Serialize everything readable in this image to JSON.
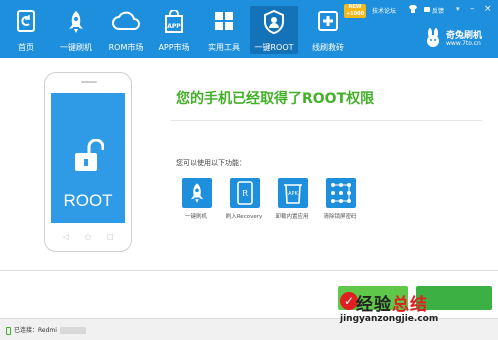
{
  "nav": {
    "items": [
      {
        "label": "首页"
      },
      {
        "label": "一键刷机"
      },
      {
        "label": "ROM市场"
      },
      {
        "label": "APP市场"
      },
      {
        "label": "实用工具"
      },
      {
        "label": "一键ROOT"
      },
      {
        "label": "线刷救砖"
      }
    ],
    "new_badge": "NEW +1000"
  },
  "top_links": {
    "forum": "技术论坛",
    "feedback": "反馈"
  },
  "brand": {
    "name": "奇兔刷机",
    "url": "www.7to.cn"
  },
  "phone": {
    "screen_text": "ROOT"
  },
  "main": {
    "headline": "您的手机已经取得了ROOT权限",
    "subtitle": "您可以使用以下功能：",
    "features": [
      {
        "label": "一键刷机"
      },
      {
        "label": "刷入Recovery"
      },
      {
        "label": "卸载内置应用"
      },
      {
        "label": "清除锁屏密码"
      }
    ]
  },
  "status": {
    "connected_label": "已连接：Redmi"
  },
  "watermark": {
    "cn_prefix": "经验",
    "cn_suffix": "总结",
    "url": "jingyanzongjie.com"
  },
  "colors": {
    "primary_blue": "#1e8fdc",
    "success_green": "#43b02a"
  }
}
